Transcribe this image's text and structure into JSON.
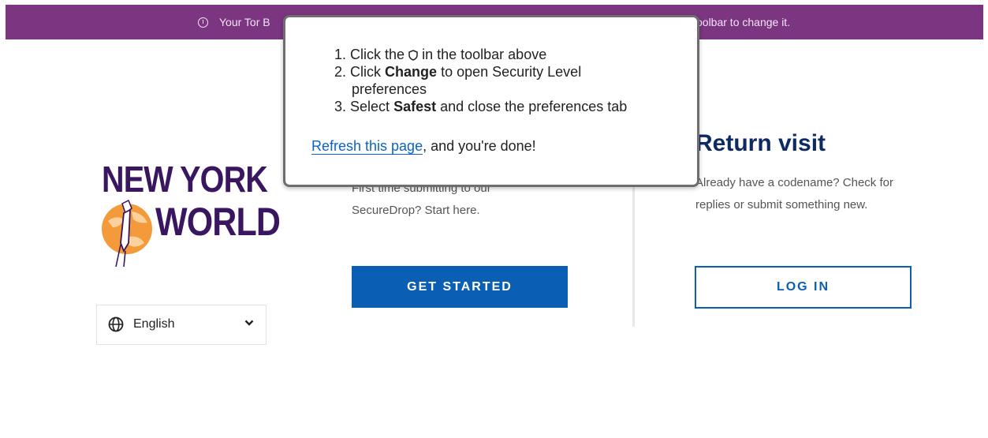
{
  "banner": {
    "text_left": "Your Tor B",
    "text_right": "oolbar to change it."
  },
  "popup": {
    "step1_num": "1.",
    "step1_pre": "Click the",
    "step1_post": "in the toolbar above",
    "step2_num": "2.",
    "step2_pre": "Click",
    "step2_bold": "Change",
    "step2_post": "to open Security Level",
    "step2_line2": "preferences",
    "step3_num": "3.",
    "step3_pre": "Select",
    "step3_bold": "Safest",
    "step3_post": "and close the preferences tab",
    "refresh_link": "Refresh this page",
    "done_text": ", and you're done!"
  },
  "logo": {
    "line1": "NEW YORK",
    "line2": "WORLD"
  },
  "language": {
    "selected": "English",
    "icon": "globe-icon"
  },
  "first_time": {
    "desc_line1": "First time submitting to our",
    "desc_line2": "SecureDrop? Start here.",
    "button": "GET STARTED"
  },
  "return_visit": {
    "title": "Return visit",
    "desc_line1": "Already have a codename? Check for",
    "desc_line2": "replies or submit something new.",
    "button": "LOG IN"
  },
  "colors": {
    "banner": "#7b3581",
    "primary": "#0a5fb4",
    "title": "#0e2a63",
    "logo": "#3a1660",
    "logo_accent": "#f39a3a"
  }
}
